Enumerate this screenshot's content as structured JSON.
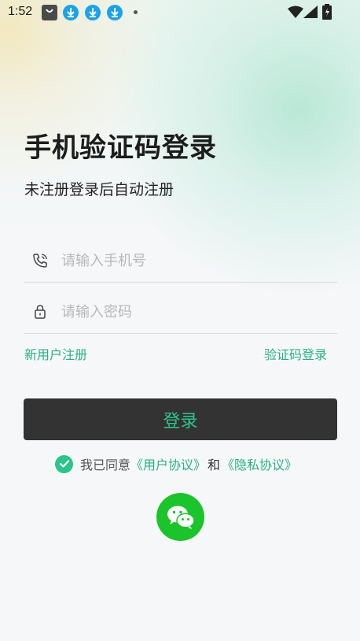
{
  "status_bar": {
    "time": "1:52",
    "icons": [
      "shop-icon",
      "download-icon",
      "download-icon",
      "download-icon",
      "dot-icon",
      "wifi-icon",
      "signal-icon",
      "battery-icon"
    ]
  },
  "login": {
    "title": "手机验证码登录",
    "subtitle": "未注册登录后自动注册",
    "phone_placeholder": "请输入手机号",
    "password_placeholder": "请输入密码",
    "register_link": "新用户注册",
    "code_login_link": "验证码登录",
    "login_button": "登录"
  },
  "agreement": {
    "prefix": "我已同意",
    "user_agreement": "《用户协议》",
    "and": "和",
    "privacy_policy": "《隐私协议》",
    "checked": true
  },
  "colors": {
    "accent": "#2ab083",
    "button_bg": "#333333",
    "wechat_green": "#1bc42a"
  }
}
